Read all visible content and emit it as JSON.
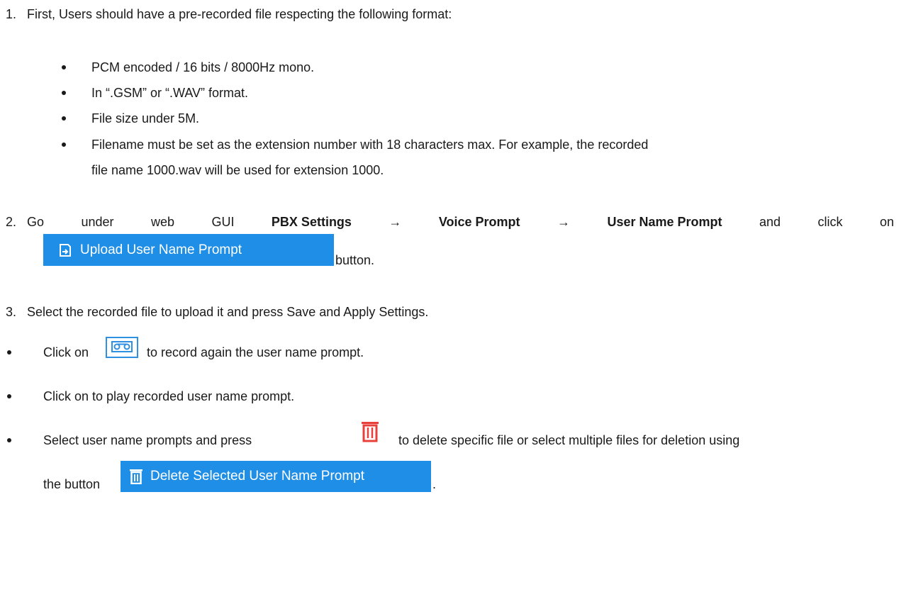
{
  "steps": {
    "step1": {
      "number": "1.",
      "text": "First, Users should have a pre-recorded file respecting the following format:"
    },
    "format_items": [
      "PCM encoded / 16 bits / 8000Hz mono.",
      "In “.GSM” or “.WAV” format.",
      "File size under 5M.",
      "Filename must be set as the extension number with 18 characters max. For example, the recorded",
      "file name 1000.wav will be used for extension 1000."
    ],
    "step2": {
      "number": "2.",
      "words": [
        "Go",
        "under",
        "web",
        "GUI"
      ],
      "bold1": "PBX Settings",
      "arrow": "→",
      "bold2": "Voice Prompt",
      "bold3": "User Name Prompt",
      "tail_words": [
        "and",
        "click",
        "on"
      ],
      "after_button": "button."
    },
    "step3": {
      "number": "3.",
      "text": "Select the recorded file to upload it and press Save and Apply Settings."
    },
    "bullets": {
      "record_before": "Click on",
      "record_after": "to record again the user name prompt.",
      "play": "Click on to play recorded user name prompt.",
      "delete_before": "Select user name prompts and press",
      "delete_after": "to delete specific file or select multiple files for deletion using",
      "delete_line2_before": "the button",
      "delete_line2_after": "."
    }
  },
  "buttons": {
    "upload_label": "Upload User Name Prompt",
    "delete_selected_label": "Delete Selected User Name Prompt"
  },
  "colors": {
    "button_blue": "#1f8ee6",
    "delete_red": "#e8403a",
    "record_blue": "#2f8fe0"
  },
  "icons": {
    "upload": "upload-icon",
    "record": "cassette-icon",
    "delete": "trash-icon"
  }
}
